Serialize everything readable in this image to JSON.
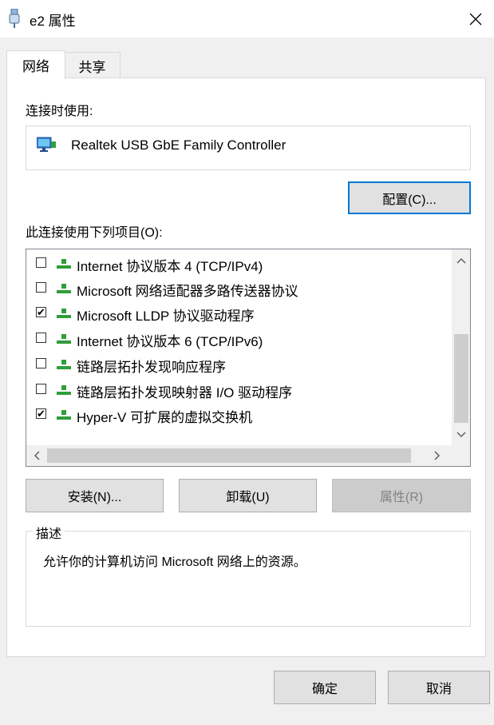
{
  "window": {
    "title": "e2 属性"
  },
  "tabs": [
    {
      "label": "网络",
      "active": true
    },
    {
      "label": "共享",
      "active": false
    }
  ],
  "connect_using": {
    "label": "连接时使用:",
    "adapter_name": "Realtek USB GbE Family Controller",
    "configure_button": "配置(C)..."
  },
  "items_section": {
    "label": "此连接使用下列项目(O):",
    "items": [
      {
        "label": "Internet 协议版本 4 (TCP/IPv4)",
        "checked": false
      },
      {
        "label": "Microsoft 网络适配器多路传送器协议",
        "checked": false
      },
      {
        "label": "Microsoft LLDP 协议驱动程序",
        "checked": true
      },
      {
        "label": "Internet 协议版本 6 (TCP/IPv6)",
        "checked": false
      },
      {
        "label": "链路层拓扑发现响应程序",
        "checked": false
      },
      {
        "label": "链路层拓扑发现映射器 I/O 驱动程序",
        "checked": false
      },
      {
        "label": "Hyper-V 可扩展的虚拟交换机",
        "checked": true
      }
    ]
  },
  "actions": {
    "install": "安装(N)...",
    "uninstall": "卸载(U)",
    "properties": "属性(R)"
  },
  "description": {
    "legend": "描述",
    "text": "允许你的计算机访问 Microsoft 网络上的资源。"
  },
  "footer": {
    "ok": "确定",
    "cancel": "取消"
  },
  "colors": {
    "focus_border": "#0078d7",
    "protocol_icon": "#2e9e3a"
  }
}
